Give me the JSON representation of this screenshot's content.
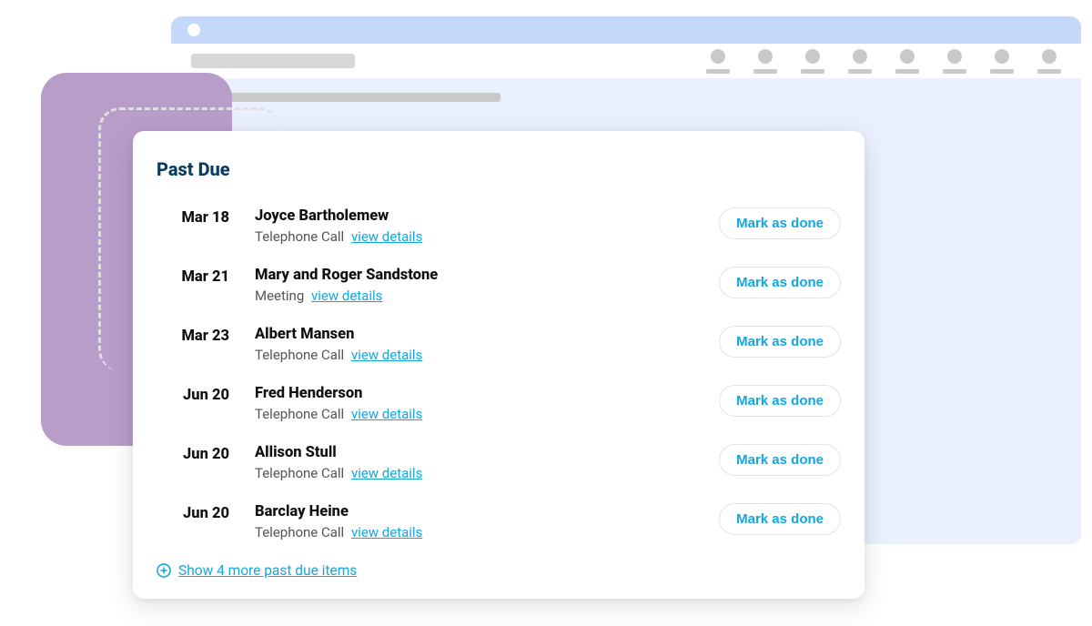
{
  "card": {
    "title": "Past Due",
    "view_details_label": "view details",
    "mark_done_label": "Mark as done",
    "show_more": "Show 4 more past due items",
    "items": [
      {
        "date": "Mar 18",
        "name": "Joyce Bartholemew",
        "type": "Telephone Call"
      },
      {
        "date": "Mar 21",
        "name": "Mary and Roger Sandstone",
        "type": "Meeting"
      },
      {
        "date": "Mar 23",
        "name": "Albert Mansen",
        "type": "Telephone Call"
      },
      {
        "date": "Jun 20",
        "name": "Fred Henderson",
        "type": "Telephone Call"
      },
      {
        "date": "Jun 20",
        "name": "Allison Stull",
        "type": "Telephone Call"
      },
      {
        "date": "Jun 20",
        "name": "Barclay Heine",
        "type": "Telephone Call"
      }
    ]
  }
}
